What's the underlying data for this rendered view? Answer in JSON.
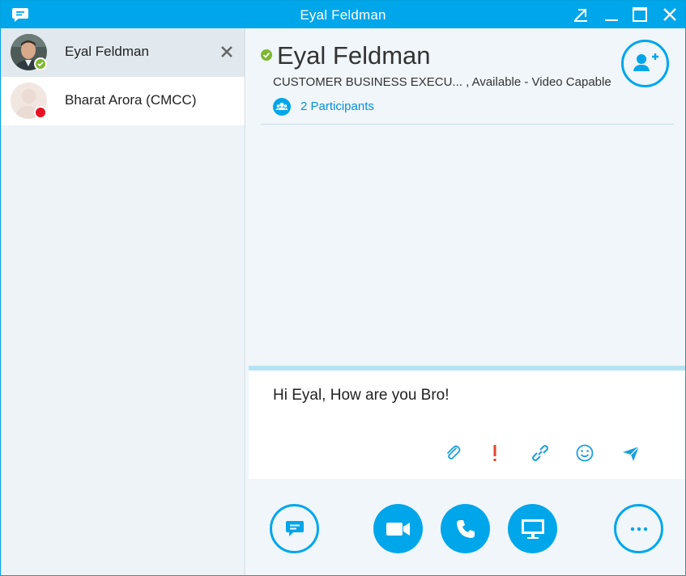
{
  "window": {
    "title": "Eyal Feldman"
  },
  "colors": {
    "accent": "#00a6ea",
    "available": "#7cb82f",
    "busy": "#e81123",
    "link": "#0a8fd6"
  },
  "sidebar": {
    "conversations": [
      {
        "name": "Eyal Feldman",
        "presence": "available",
        "active": true
      },
      {
        "name": "Bharat Arora (CMCC)",
        "presence": "busy",
        "active": false
      }
    ]
  },
  "conversation": {
    "contact_name": "Eyal Feldman",
    "status_line": "CUSTOMER BUSINESS EXECU... , Available - Video Capable",
    "participants_label": "2 Participants"
  },
  "compose": {
    "message": "Hi Eyal, How are you Bro!",
    "tools": [
      "paperclip-icon",
      "exclamation-icon",
      "link-icon",
      "smiley-icon",
      "send-icon"
    ]
  },
  "actions": [
    "im-button",
    "video-button",
    "call-button",
    "present-button",
    "more-options-button"
  ]
}
